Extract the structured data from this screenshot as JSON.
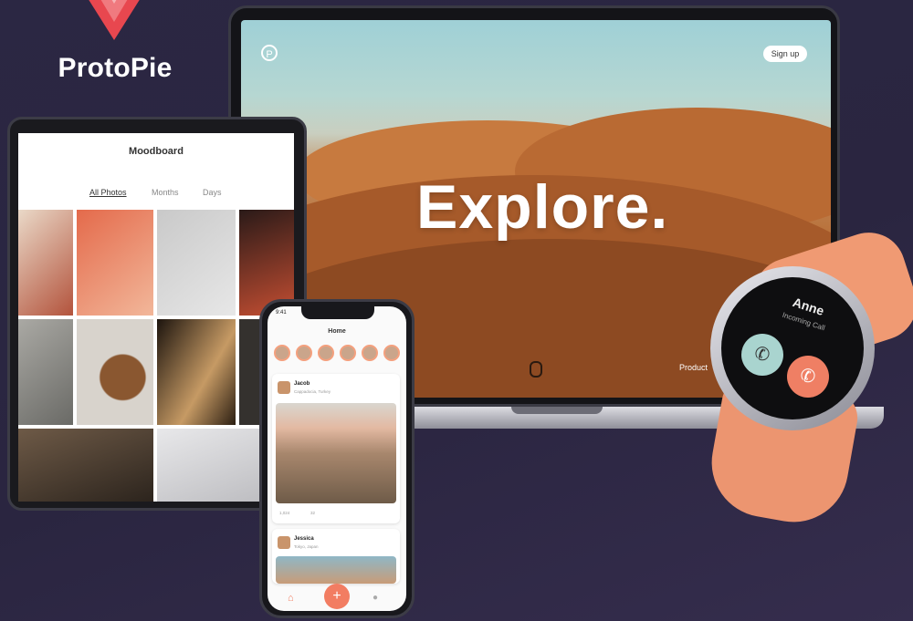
{
  "brand": {
    "name": "ProtoPie",
    "logo_icon": "protopie-logo-icon",
    "accent": "#e8474f"
  },
  "laptop": {
    "hero_text": "Explore.",
    "signup_label": "Sign up",
    "p_icon_label": "P",
    "footer_label": "Product"
  },
  "tablet": {
    "title": "Moodboard",
    "tabs": [
      "All Photos",
      "Months",
      "Days"
    ]
  },
  "phone": {
    "time": "9:41",
    "title": "Home",
    "posts": [
      {
        "name": "Jacob",
        "subtitle": "Cappadocia, Turkey"
      },
      {
        "name": "Jessica",
        "subtitle": "Tokyo, Japan"
      }
    ],
    "likes": "1,024",
    "comments": "32",
    "fab_icon": "plus-icon"
  },
  "watch": {
    "caller": "Anne",
    "caller_sub": "Incoming Call",
    "accept_icon": "phone-accept-icon",
    "decline_icon": "phone-decline-icon",
    "accept_color": "#a9d4cf",
    "decline_color": "#ef7f64"
  }
}
